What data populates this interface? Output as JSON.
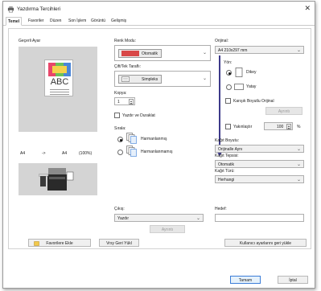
{
  "window": {
    "title": "Yazdırma Tercihleri",
    "close_glyph": "✕"
  },
  "tabs": [
    "Temel",
    "Favoriler",
    "Düzen",
    "Son İşlem",
    "Görüntü",
    "Gelişmiş"
  ],
  "preview": {
    "header": "Geçerli Ayar",
    "page_text": "ABC",
    "src_size": "A4",
    "arrow": "->",
    "dst_size": "A4",
    "scale": "(100%)"
  },
  "color_mode": {
    "label": "Renk Modu:",
    "value": "Otomatik"
  },
  "duplex": {
    "label": "Çift/Tek Taraflı:",
    "value": "Simpleks"
  },
  "copies": {
    "label": "Kopya:",
    "value": "1"
  },
  "print_and_pause": {
    "label": "Yazdır ve Duraklat",
    "checked": false
  },
  "collate": {
    "label": "Sırala:",
    "options": [
      {
        "label": "Harmanlanmış",
        "selected": true
      },
      {
        "label": "Harmanlanmamış",
        "selected": false
      }
    ]
  },
  "original": {
    "label": "Orijinal:",
    "value": "A4 210x297 mm",
    "orientation_label": "Yön:",
    "orientations": [
      {
        "label": "Dikey",
        "selected": true
      },
      {
        "label": "Yatay",
        "selected": false
      }
    ],
    "mixed_label": "Karışık Boyutlu Orijinal",
    "mixed_checked": false,
    "detail_button": "Ayrıntı"
  },
  "zoom": {
    "label": "Yakınlaştır",
    "value": "100",
    "unit": "%",
    "checked": false
  },
  "paper_size": {
    "label": "Kağıt Boyutu:",
    "value": "Orijinalle Aynı"
  },
  "paper_tray": {
    "label": "Kağıt Tepsisi:",
    "value": "Otomatik"
  },
  "paper_type": {
    "label": "Kağıt Türü:",
    "value": "Herhangi"
  },
  "output": {
    "label": "Çıkış:",
    "value": "Yazdır",
    "detail_button": "Ayrıntı"
  },
  "destination": {
    "label": "Hedef:",
    "value": ""
  },
  "footer": {
    "add_favorite": "Favorilere Ekle",
    "restore_default": "Vrsy Geri Yükl",
    "restore_user": "Kullanıcı ayarlarını geri yükle",
    "ok": "Tamam",
    "cancel": "İptal"
  },
  "colors": {
    "accent_arrow": "#3d3a8a",
    "primary_border": "#3b7dd8",
    "panel_gray": "#d4d4d4"
  }
}
